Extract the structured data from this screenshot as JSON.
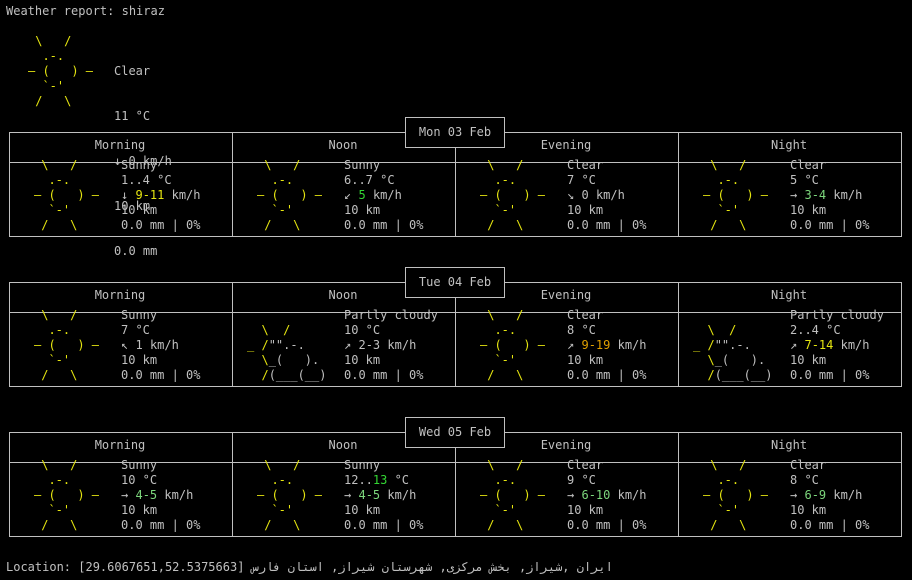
{
  "title": "Weather report: shiraz",
  "current": {
    "art": [
      " \\   /    ",
      "  .-.     ",
      "― (   ) ― ",
      "  `-'     ",
      " /   \\    "
    ],
    "condition": "Clear",
    "temp": "11 °C",
    "wind_arrow": "↓",
    "wind": "0",
    "wind_unit": "km/h",
    "visibility": "10 km",
    "precip": "0.0 mm"
  },
  "columns": [
    "Morning",
    "Noon",
    "Evening",
    "Night"
  ],
  "art_sun": [
    " \\   /    ",
    "  .-.     ",
    "― (   ) ― ",
    "  `-'     ",
    " /   \\    "
  ],
  "art_pc_sun": [
    "  \\  /",
    "_ /\"\".-.",
    "  \\_(   ).",
    "  /(___(__)"
  ],
  "days": [
    {
      "date": "Mon 03 Feb",
      "periods": [
        {
          "art": "sun",
          "condition": "Sunny",
          "temp": "1..4 °C",
          "wind_arrow": "↓",
          "wind": "9-11",
          "wind_color": "#e5e510",
          "wind_unit": "km/h",
          "visibility": "10 km",
          "precip": "0.0 mm | 0%"
        },
        {
          "art": "sun",
          "condition": "Sunny",
          "temp": "6..7 °C",
          "wind_arrow": "↙",
          "wind": "5",
          "wind_color": "#33d633",
          "wind_unit": "km/h",
          "visibility": "10 km",
          "precip": "0.0 mm | 0%"
        },
        {
          "art": "sun",
          "condition": "Clear",
          "temp": "7 °C",
          "wind_arrow": "↘",
          "wind": "0",
          "wind_color": "",
          "wind_unit": "km/h",
          "visibility": "10 km",
          "precip": "0.0 mm | 0%"
        },
        {
          "art": "sun",
          "condition": "Clear",
          "temp": "5 °C",
          "wind_arrow": "→",
          "wind": "3-4",
          "wind_color": "#7cd67c",
          "wind_unit": "km/h",
          "visibility": "10 km",
          "precip": "0.0 mm | 0%"
        }
      ]
    },
    {
      "date": "Tue 04 Feb",
      "periods": [
        {
          "art": "sun",
          "condition": "Sunny",
          "temp": "7 °C",
          "wind_arrow": "↖",
          "wind": "1",
          "wind_color": "",
          "wind_unit": "km/h",
          "visibility": "10 km",
          "precip": "0.0 mm | 0%"
        },
        {
          "art": "pc",
          "condition": "Partly cloudy",
          "temp": "10 °C",
          "wind_arrow": "↗",
          "wind": "2-3",
          "wind_color": "",
          "wind_unit": "km/h",
          "visibility": "10 km",
          "precip": "0.0 mm | 0%"
        },
        {
          "art": "sun",
          "condition": "Clear",
          "temp": "8 °C",
          "wind_arrow": "↗",
          "wind": "9-19",
          "wind_color": "#e0a000",
          "wind_unit": "km/h",
          "visibility": "10 km",
          "precip": "0.0 mm | 0%"
        },
        {
          "art": "pc",
          "condition": "Partly cloudy",
          "temp": "2..4 °C",
          "wind_arrow": "↗",
          "wind": "7-14",
          "wind_color": "#e5e510",
          "wind_unit": "km/h",
          "visibility": "10 km",
          "precip": "0.0 mm | 0%"
        }
      ]
    },
    {
      "date": "Wed 05 Feb",
      "periods": [
        {
          "art": "sun",
          "condition": "Sunny",
          "temp": "10 °C",
          "wind_arrow": "→",
          "wind": "4-5",
          "wind_color": "#7cd67c",
          "wind_unit": "km/h",
          "visibility": "10 km",
          "precip": "0.0 mm | 0%"
        },
        {
          "art": "sun",
          "condition": "Sunny",
          "temp_prefix": "12..",
          "temp_hi": "13",
          "temp_suffix": " °C",
          "temp_hi_color": "#33d633",
          "wind_arrow": "→",
          "wind": "4-5",
          "wind_color": "#7cd67c",
          "wind_unit": "km/h",
          "visibility": "10 km",
          "precip": "0.0 mm | 0%"
        },
        {
          "art": "sun",
          "condition": "Clear",
          "temp": "9 °C",
          "wind_arrow": "→",
          "wind": "6-10",
          "wind_color": "#7cd67c",
          "wind_unit": "km/h",
          "visibility": "10 km",
          "precip": "0.0 mm | 0%"
        },
        {
          "art": "sun",
          "condition": "Clear",
          "temp": "8 °C",
          "wind_arrow": "→",
          "wind": "6-9",
          "wind_color": "#7cd67c",
          "wind_unit": "km/h",
          "visibility": "10 km",
          "precip": "0.0 mm | 0%"
        }
      ]
    }
  ],
  "location": "Location: ایران ,شیراز, بخش مرکزی, شهرستان شیراز, استان فارس [29.6067651,52.5375663]"
}
